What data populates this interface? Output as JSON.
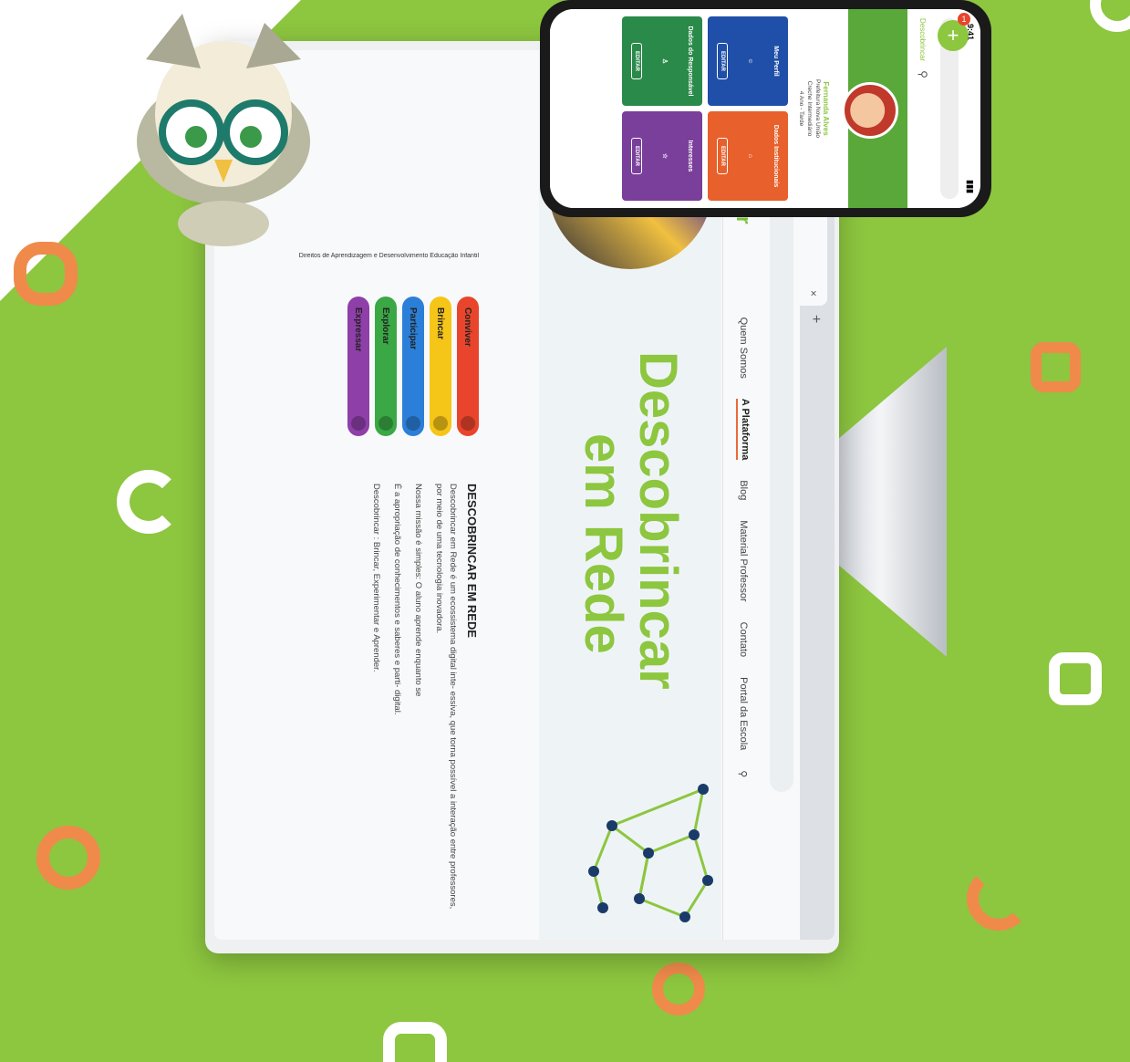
{
  "browser": {
    "tab_close": "×",
    "tab_new": "+",
    "nav_back": "←",
    "nav_forward": "→",
    "nav_reload": "⟳",
    "search_glyph": "⚲"
  },
  "site": {
    "logo": "Descobrincar",
    "nav": [
      "Quem Somos",
      "A Plataforma",
      "Blog",
      "Material Professor",
      "Contato",
      "Portal da Escola"
    ],
    "hero_line1": "Descobrincar",
    "hero_line2": "em Rede",
    "pills_caption": "Direitos de Aprendizagem e Desenvolvimento Educação Infantil",
    "pills": [
      {
        "label": "Conviver",
        "color": "#e8452c"
      },
      {
        "label": "Brincar",
        "color": "#f5c518"
      },
      {
        "label": "Participar",
        "color": "#2b7fd8"
      },
      {
        "label": "Explorar",
        "color": "#3aa845"
      },
      {
        "label": "Expressar",
        "color": "#8e3fa8"
      }
    ],
    "about_title": "DESCOBRINCAR EM REDE",
    "about_paragraphs": [
      "Descobrincar em Rede é um ecossistema digital inte- essiva, que torna possível a interação entre professores, por meio de uma tecnologia inovadora.",
      "Nossa missão é simples: O aluno aprende enquanto se",
      "É a apropriação de conhecimentos e saberes e parti- digital.",
      "Descobrincar : Brincar, Experimentar e Aprender."
    ]
  },
  "phone": {
    "time": "9:41",
    "search_close": "×",
    "profile_name": "Fernanda Alves",
    "profile_school": "Prefeitura Nova União",
    "profile_sub": "Creche Intermediário",
    "profile_shift": "4 Ano - Tarde",
    "cards": [
      {
        "title": "Meu Perfil",
        "button": "EDITAR",
        "color": "#1f4fa8"
      },
      {
        "title": "Dados Institucionais",
        "button": "EDITAR",
        "color": "#e8602c"
      },
      {
        "title": "Dados do Responsável",
        "button": "EDITAR",
        "color": "#2a8a4a"
      },
      {
        "title": "Interesses",
        "button": "EDITAR",
        "color": "#7a3f9a"
      }
    ],
    "badge": "1"
  }
}
